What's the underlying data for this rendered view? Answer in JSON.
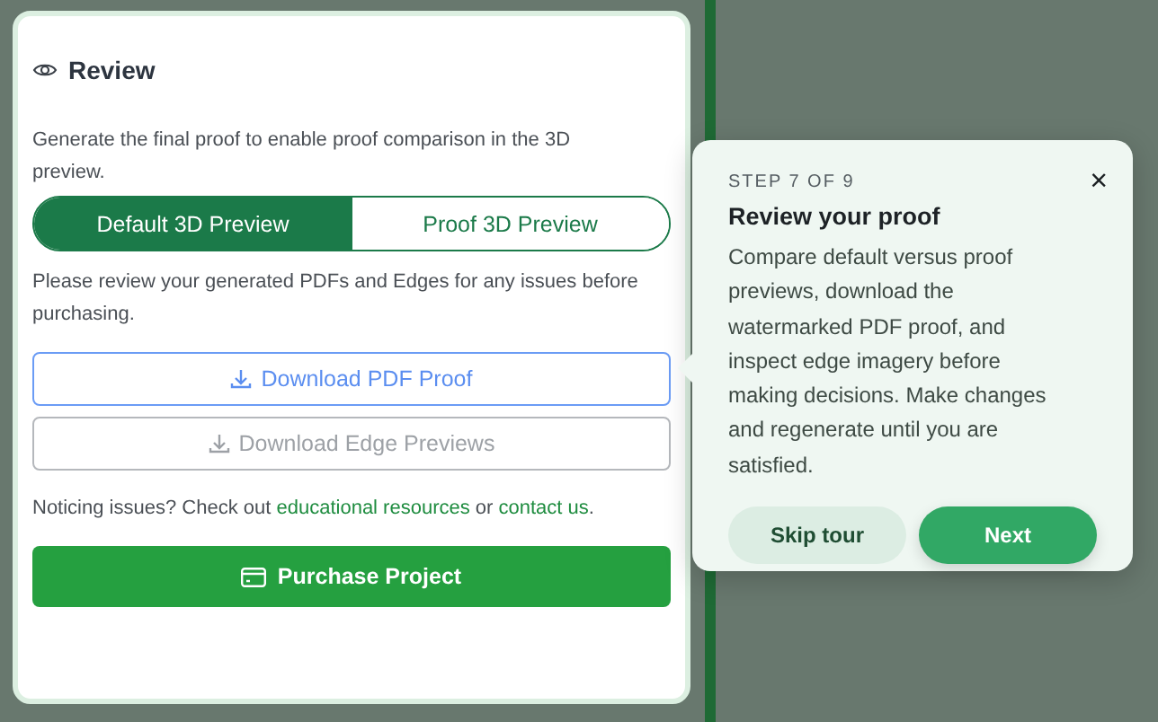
{
  "panel": {
    "title": "Review",
    "intro": "Generate the final proof to enable proof comparison in the 3D preview.",
    "preview_toggle": [
      {
        "label": "Default 3D Preview",
        "selected": true
      },
      {
        "label": "Proof 3D Preview",
        "selected": false
      }
    ],
    "instructions": "Please review your generated PDFs and Edges for any issues before purchasing.",
    "downloads": [
      {
        "label": "Download PDF Proof",
        "disabled": false
      },
      {
        "label": "Download Edge Previews",
        "disabled": true
      }
    ],
    "notice": {
      "before": "Noticing issues? Check out ",
      "link_1": "educational resources",
      "between": " or ",
      "link_2": "contact us",
      "after": "."
    },
    "purchase_button": "Purchase Project"
  },
  "tour": {
    "step": "STEP 7 OF 9",
    "close": "×",
    "title": "Review your proof",
    "body": "Compare default versus proof previews, download the watermarked PDF proof, and inspect edge imagery before making decisions. Make changes and regenerate until you are satisfied.",
    "skip": "Skip tour",
    "next": "Next"
  }
}
